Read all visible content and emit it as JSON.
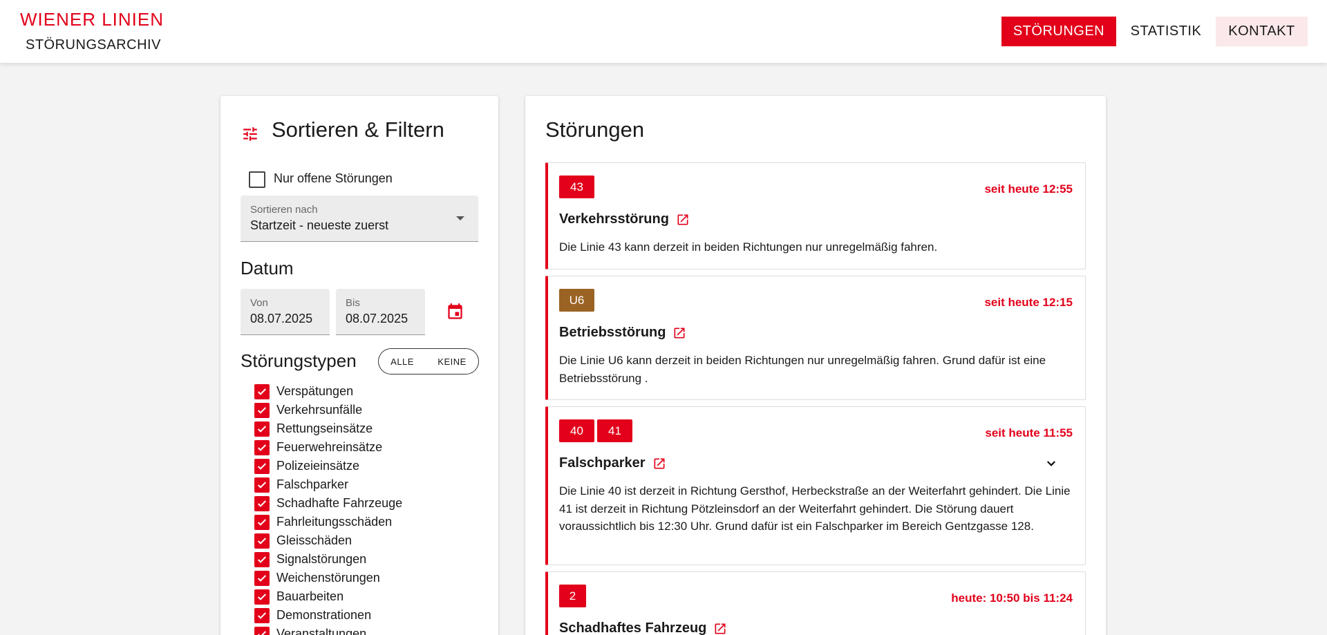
{
  "header": {
    "title": "WIENER LINIEN",
    "subtitle": "STÖRUNGSARCHIV",
    "nav": [
      "STÖRUNGEN",
      "STATISTIK",
      "KONTAKT"
    ]
  },
  "filter": {
    "title": "Sortieren & Filtern",
    "icon": "tune-icon",
    "open_only_label": "Nur offene Störungen",
    "sort_caption": "Sortieren nach",
    "sort_value": "Startzeit - neueste zuerst",
    "date_heading": "Datum",
    "date_from_caption": "Von",
    "date_from_value": "08.07.2025",
    "date_to_caption": "Bis",
    "date_to_value": "08.07.2025",
    "types_heading": "Störungstypen",
    "all_label": "ALLE",
    "none_label": "KEINE",
    "types": [
      "Verspätungen",
      "Verkehrsunfälle",
      "Rettungseinsätze",
      "Feuerwehreinsätze",
      "Polizeieinsätze",
      "Falschparker",
      "Schadhafte Fahrzeuge",
      "Fahrleitungsschäden",
      "Gleisschäden",
      "Signalstörungen",
      "Weichenstörungen",
      "Bauarbeiten",
      "Demonstrationen",
      "Veranstaltungen"
    ]
  },
  "list": {
    "title": "Störungen",
    "items": [
      {
        "badges": [
          "43"
        ],
        "since": "seit heute 12:55",
        "title": "Verkehrsstörung",
        "text": "Die Linie 43 kann derzeit in beiden Richtungen nur unregelmäßig fahren."
      },
      {
        "badges": [
          "U6"
        ],
        "since": "seit heute 12:15",
        "title": "Betriebsstörung",
        "text": "Die Linie U6 kann derzeit in beiden Richtungen nur unregelmäßig fahren. Grund dafür ist eine Betriebsstörung ."
      },
      {
        "badges": [
          "40",
          "41"
        ],
        "since": "seit heute 11:55",
        "title": "Falschparker",
        "text": "Die Linie 40 ist derzeit in Richtung Gersthof, Herbeckstraße an der Weiterfahrt gehindert. Die Linie 41 ist derzeit in Richtung Pötzleinsdorf an der Weiterfahrt gehindert. Die Störung dauert voraussichtlich bis 12:30 Uhr. Grund dafür ist ein Falschparker im Bereich Gentzgasse 128."
      },
      {
        "badges": [
          "2"
        ],
        "since": "heute: 10:50 bis 11:24",
        "title": "Schadhaftes Fahrzeug",
        "text": ""
      }
    ]
  },
  "colors": {
    "accent": "#e2001a",
    "u6": "#9a6324",
    "accent_light": "#fbe8ea"
  }
}
